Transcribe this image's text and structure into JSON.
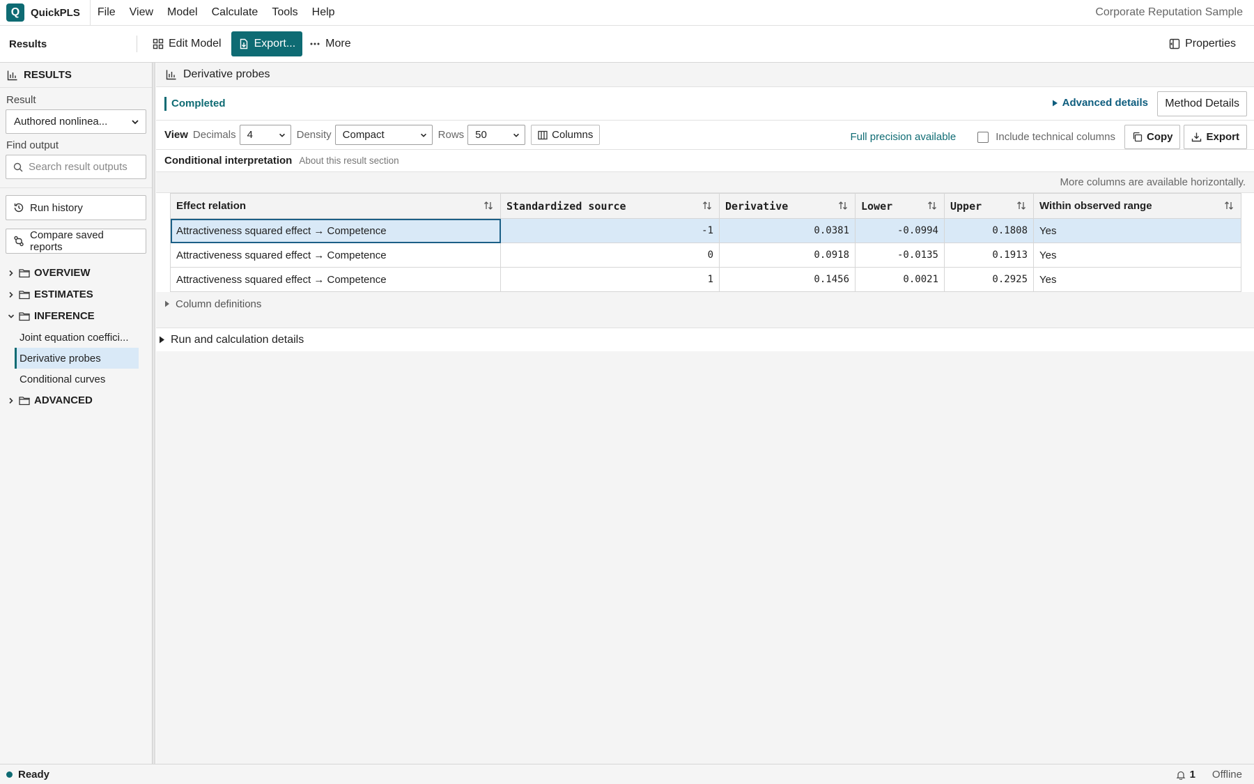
{
  "app": {
    "logo_letter": "Q",
    "name": "QuickPLS",
    "menu": [
      "File",
      "View",
      "Model",
      "Calculate",
      "Tools",
      "Help"
    ],
    "project": "Corporate Reputation Sample"
  },
  "toolbar": {
    "title": "Results",
    "edit_model": "Edit Model",
    "export": "Export...",
    "more": "More",
    "properties": "Properties"
  },
  "sidebar": {
    "header": "RESULTS",
    "result_label": "Result",
    "result_value": "Authored nonlinea...",
    "find_label": "Find output",
    "search_placeholder": "Search result outputs",
    "run_history": "Run history",
    "compare": "Compare saved reports",
    "groups": {
      "overview": "OVERVIEW",
      "estimates": "ESTIMATES",
      "inference": "INFERENCE",
      "advanced": "ADVANCED"
    },
    "inference_items": [
      "Joint equation coeffici...",
      "Derivative probes",
      "Conditional curves"
    ]
  },
  "main": {
    "title": "Derivative probes",
    "status": "Completed",
    "advanced_details": "Advanced details",
    "method_details": "Method Details",
    "view": {
      "label": "View",
      "decimals_label": "Decimals",
      "decimals_value": "4",
      "density_label": "Density",
      "density_value": "Compact",
      "rows_label": "Rows",
      "rows_value": "50",
      "columns_button": "Columns",
      "precision_note": "Full precision available",
      "technical_columns": "Include technical columns",
      "copy": "Copy",
      "export": "Export"
    },
    "section": {
      "title": "Conditional interpretation",
      "about": "About this result section"
    },
    "more_columns_note": "More columns are available horizontally.",
    "table": {
      "headers": [
        "Effect relation",
        "Standardized source",
        "Derivative",
        "Lower",
        "Upper",
        "Within observed range"
      ],
      "rows": [
        [
          "Attractiveness squared effect → Competence",
          "-1",
          "0.0381",
          "-0.0994",
          "0.1808",
          "Yes"
        ],
        [
          "Attractiveness squared effect → Competence",
          "0",
          "0.0918",
          "-0.0135",
          "0.1913",
          "Yes"
        ],
        [
          "Attractiveness squared effect → Competence",
          "1",
          "0.1456",
          "0.0021",
          "0.2925",
          "Yes"
        ]
      ]
    },
    "column_definitions": "Column definitions",
    "run_details": "Run and calculation details"
  },
  "statusbar": {
    "status": "Ready",
    "notifications": "1",
    "connection": "Offline"
  },
  "colors": {
    "accent": "#0e6b73",
    "selection": "#d9e9f7",
    "link": "#0e5d7e"
  }
}
